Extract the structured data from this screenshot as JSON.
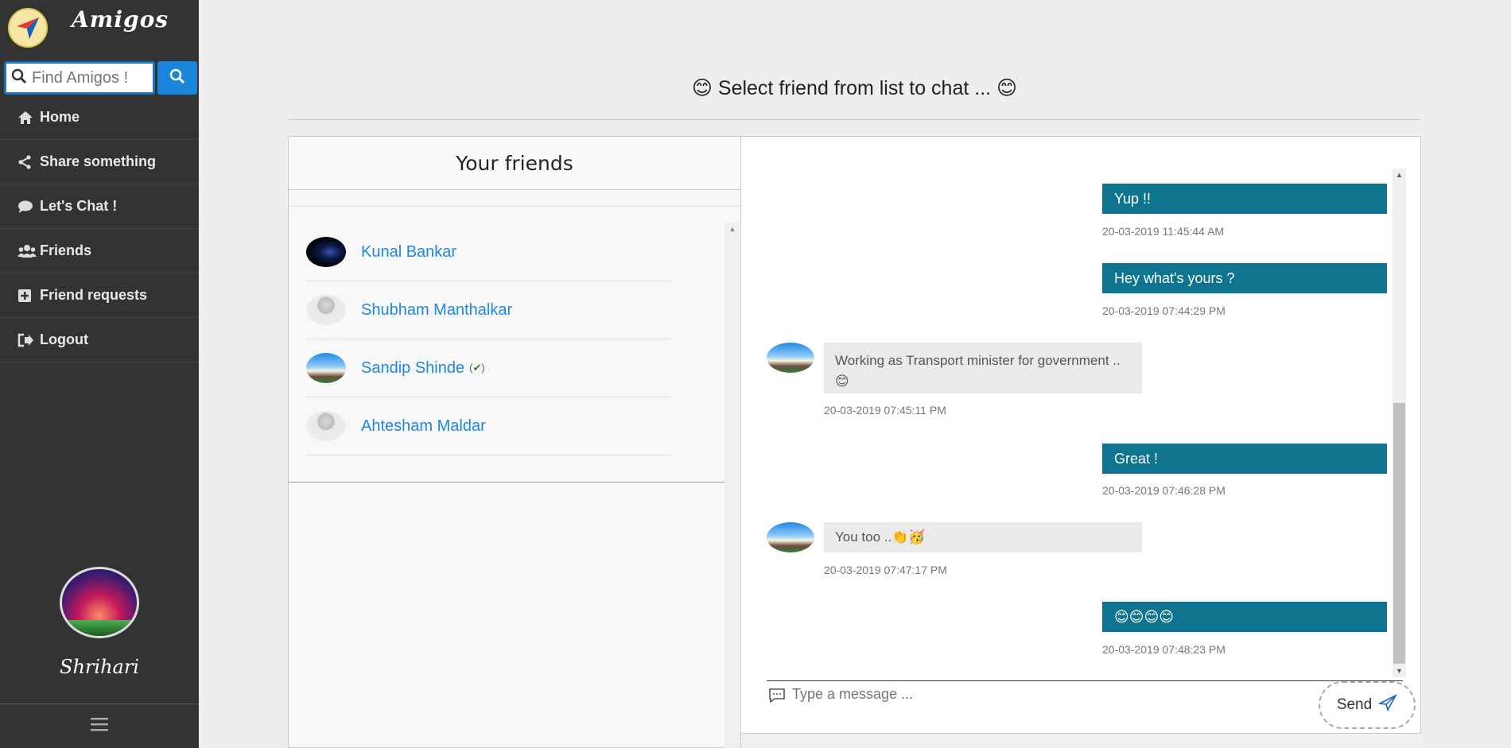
{
  "app": {
    "name": "Amigos"
  },
  "search": {
    "placeholder": "Find Amigos !"
  },
  "nav": [
    {
      "label": "Home",
      "icon": "home-icon"
    },
    {
      "label": "Share something",
      "icon": "share-icon"
    },
    {
      "label": "Let's Chat !",
      "icon": "chat-bubble-icon"
    },
    {
      "label": "Friends",
      "icon": "users-icon"
    },
    {
      "label": "Friend requests",
      "icon": "plus-square-icon"
    },
    {
      "label": "Logout",
      "icon": "logout-icon"
    }
  ],
  "profile": {
    "name": "Shrihari"
  },
  "page": {
    "title": "😊 Select friend from list to chat ... 😊"
  },
  "friends": {
    "heading": "Your friends",
    "items": [
      {
        "name": "Kunal Bankar",
        "verified": false
      },
      {
        "name": "Shubham Manthalkar",
        "verified": false
      },
      {
        "name": "Sandip Shinde",
        "verified": true,
        "verified_mark": "(✔)"
      },
      {
        "name": "Ahtesham Maldar",
        "verified": false
      }
    ]
  },
  "chat": {
    "messages": [
      {
        "direction": "out",
        "text": "Yup !!",
        "time": "20-03-2019 11:45:44 AM"
      },
      {
        "direction": "out",
        "text": "Hey what's yours ?",
        "time": "20-03-2019 07:44:29 PM"
      },
      {
        "direction": "in",
        "text": "Working as Transport minister for government .. 😊",
        "time": "20-03-2019 07:45:11 PM"
      },
      {
        "direction": "out",
        "text": "Great !",
        "time": "20-03-2019 07:46:28 PM"
      },
      {
        "direction": "in",
        "text": "You too ..👏🥳",
        "time": "20-03-2019 07:47:17 PM"
      },
      {
        "direction": "out",
        "text": "😊😊😊😊",
        "time": "20-03-2019 07:48:23 PM"
      }
    ],
    "composer": {
      "placeholder": "Type a message ...",
      "send_label": "Send"
    }
  },
  "colors": {
    "sidebar": "#333333",
    "accent": "#1a86d9",
    "bubble_out": "#0e7490",
    "link": "#1e88e5"
  }
}
